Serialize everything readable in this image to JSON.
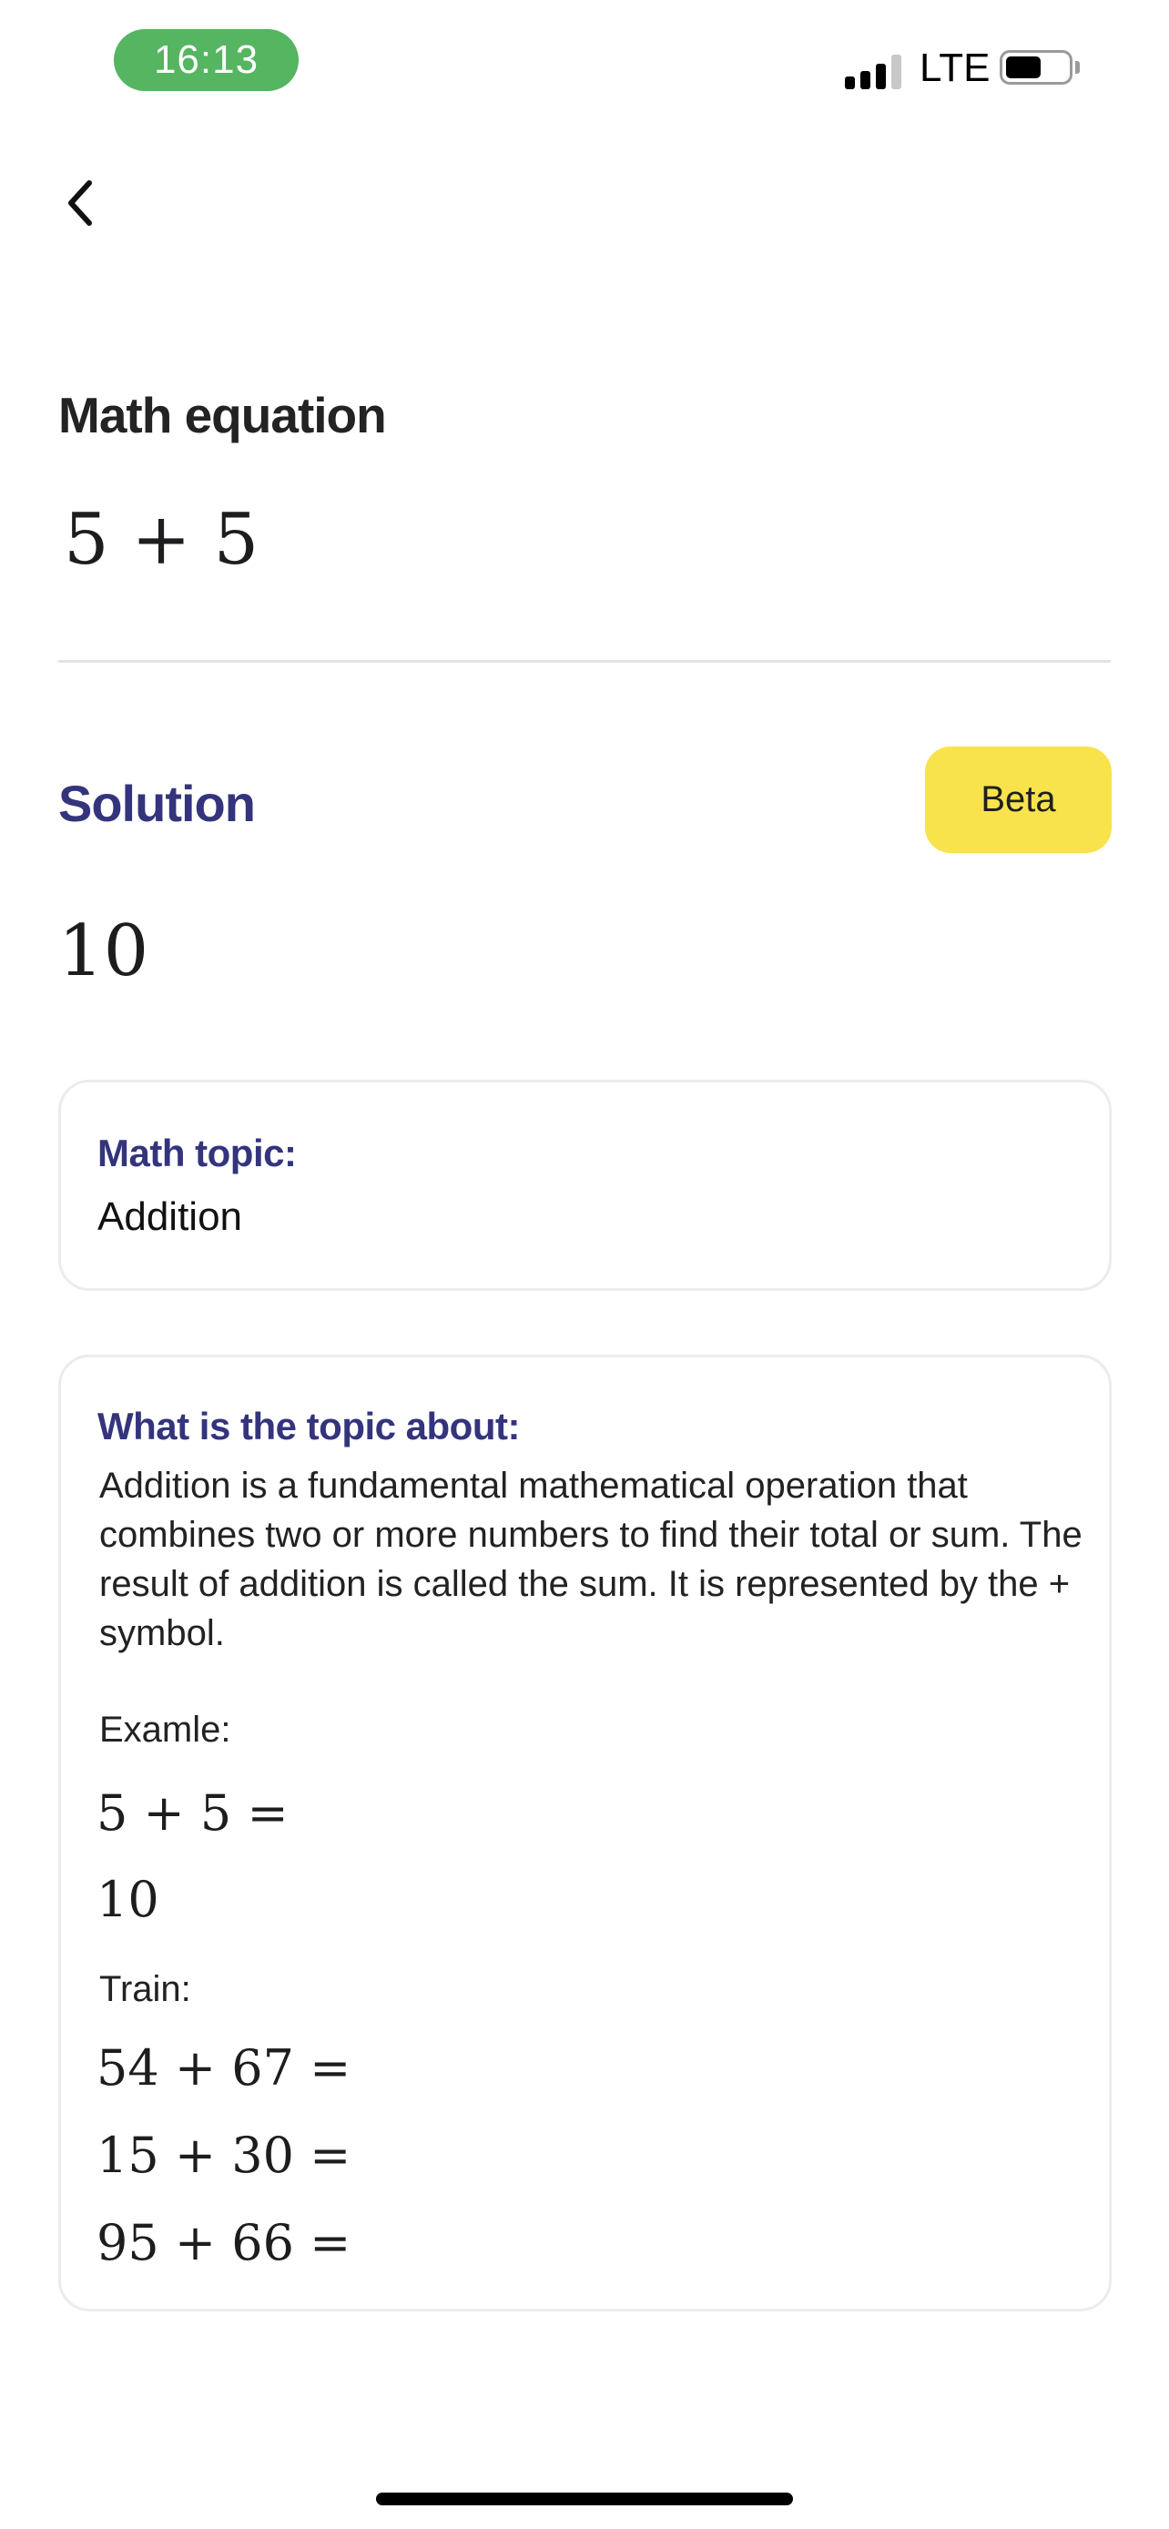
{
  "status_bar": {
    "time": "16:13",
    "network": "LTE",
    "signal_bars_filled": 3,
    "signal_bars_total": 4,
    "signal_icon": "cellular-signal-icon",
    "battery_icon": "battery-icon"
  },
  "nav": {
    "back_icon": "chevron-left-icon"
  },
  "equation": {
    "heading": "Math equation",
    "expression": "5 + 5"
  },
  "solution": {
    "title": "Solution",
    "badge": "Beta",
    "answer": "10"
  },
  "topic_card": {
    "label": "Math topic:",
    "value": "Addition"
  },
  "about_card": {
    "label": "What is the topic about:",
    "description": "Addition is a fundamental mathematical operation that combines two or more numbers to find their total or sum. The result of addition is called the sum. It is represented by the + symbol.",
    "example_label": "Examle:",
    "example_expression": "5 + 5 =",
    "example_result": "10",
    "train_label": "Train:",
    "train": [
      "54 + 67 =",
      "15 + 30 =",
      "95 + 66 ="
    ]
  },
  "colors": {
    "accent": "#34347d",
    "badge_bg": "#f8e34c",
    "time_pill": "#55b560"
  }
}
